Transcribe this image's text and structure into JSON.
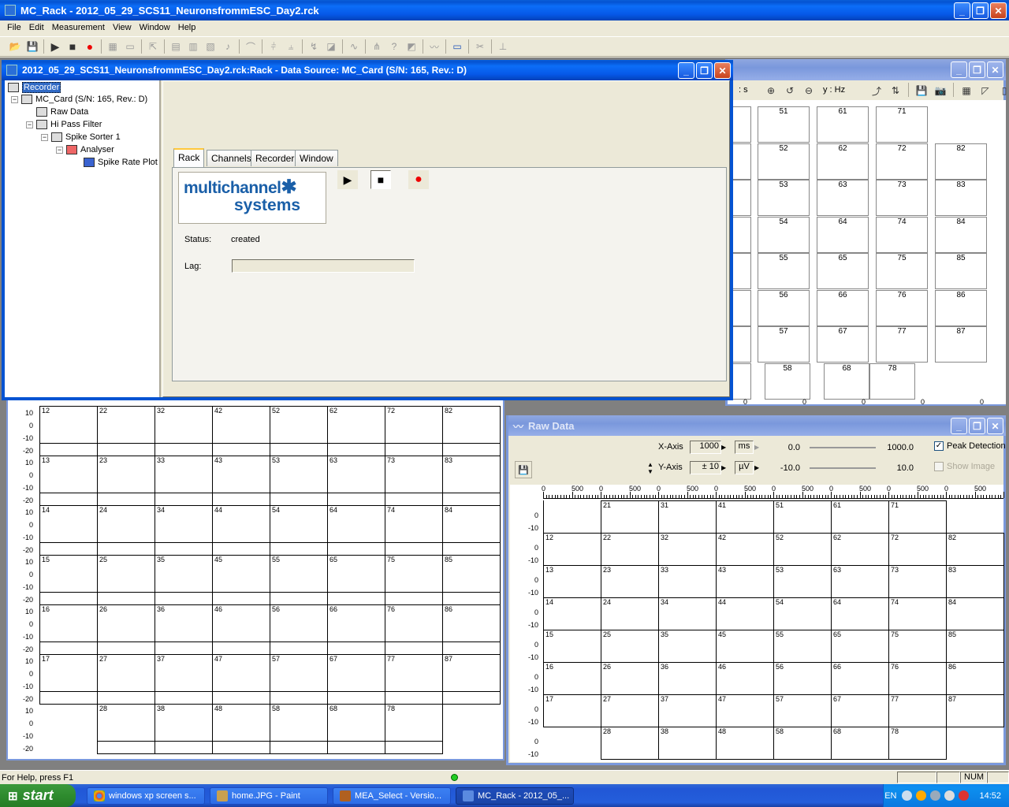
{
  "app": {
    "title": "MC_Rack - 2012_05_29_SCS11_NeuronsfrommESC_Day2.rck"
  },
  "menu": [
    "File",
    "Edit",
    "Measurement",
    "View",
    "Window",
    "Help"
  ],
  "rack": {
    "title": "2012_05_29_SCS11_NeuronsfrommESC_Day2.rck:Rack - Data Source: MC_Card (S/N: 165, Rev.: D)",
    "tree": [
      "Recorder",
      "MC_Card (S/N: 165, Rev.: D)",
      "Raw Data",
      "Hi Pass Filter",
      "Spike Sorter 1",
      "Analyser",
      "Spike Rate Plot"
    ],
    "tabs": [
      "Rack",
      "Channels",
      "Recorder",
      "Window"
    ],
    "logo_line1": "multichannel",
    "logo_line2": "systems",
    "status_label": "Status:",
    "status_value": "created",
    "lag_label": "Lag:"
  },
  "spikeplot": {
    "xlabel": ": s",
    "ylabel": "y : Hz",
    "cols": [
      [
        "51",
        "52",
        "53",
        "54",
        "55",
        "56",
        "57",
        "58"
      ],
      [
        "61",
        "62",
        "63",
        "64",
        "65",
        "66",
        "67",
        "68"
      ],
      [
        "71",
        "72",
        "73",
        "74",
        "75",
        "76",
        "77",
        "78"
      ],
      [
        "",
        "82",
        "83",
        "84",
        "85",
        "86",
        "87",
        ""
      ]
    ],
    "bottom_ticks": [
      "0",
      "0",
      "0",
      "0",
      "0",
      "0"
    ]
  },
  "bgwin": {
    "ylabels": [
      "10",
      "0",
      "-10",
      "-20"
    ],
    "rows": [
      [
        "12",
        "22",
        "32",
        "42",
        "52",
        "62",
        "72",
        "82"
      ],
      [
        "13",
        "23",
        "33",
        "43",
        "53",
        "63",
        "73",
        "83"
      ],
      [
        "14",
        "24",
        "34",
        "44",
        "54",
        "64",
        "74",
        "84"
      ],
      [
        "15",
        "25",
        "35",
        "45",
        "55",
        "65",
        "75",
        "85"
      ],
      [
        "16",
        "26",
        "36",
        "46",
        "56",
        "66",
        "76",
        "86"
      ],
      [
        "17",
        "27",
        "37",
        "47",
        "57",
        "67",
        "77",
        "87"
      ],
      [
        "",
        "28",
        "38",
        "48",
        "58",
        "68",
        "78",
        ""
      ]
    ]
  },
  "rawdata": {
    "title": "Raw Data",
    "xaxis_label": "X-Axis",
    "xaxis_value": "1000",
    "xaxis_unit": "ms",
    "yaxis_label": "Y-Axis",
    "yaxis_value": "± 10",
    "yaxis_unit": "µV",
    "x_min": "0.0",
    "x_max": "1000.0",
    "y_min": "-10.0",
    "y_max": "10.0",
    "peak_detection": "Peak Detection",
    "show_image": "Show Image",
    "ruler_labels": [
      "0",
      "500",
      "0",
      "500",
      "0",
      "500",
      "0",
      "500",
      "0",
      "500",
      "0",
      "500",
      "0",
      "500",
      "0",
      "500"
    ],
    "ylabels": [
      "0",
      "-10"
    ],
    "rows": [
      [
        "",
        "21",
        "31",
        "41",
        "51",
        "61",
        "71",
        ""
      ],
      [
        "12",
        "22",
        "32",
        "42",
        "52",
        "62",
        "72",
        "82"
      ],
      [
        "13",
        "23",
        "33",
        "43",
        "53",
        "63",
        "73",
        "83"
      ],
      [
        "14",
        "24",
        "34",
        "44",
        "54",
        "64",
        "74",
        "84"
      ],
      [
        "15",
        "25",
        "35",
        "45",
        "55",
        "65",
        "75",
        "85"
      ],
      [
        "16",
        "26",
        "36",
        "46",
        "56",
        "66",
        "76",
        "86"
      ],
      [
        "17",
        "27",
        "37",
        "47",
        "57",
        "67",
        "77",
        "87"
      ],
      [
        "",
        "28",
        "38",
        "48",
        "58",
        "68",
        "78",
        ""
      ]
    ]
  },
  "status": {
    "help": "For Help, press F1",
    "num": "NUM"
  },
  "taskbar": {
    "start": "start",
    "tasks": [
      "windows xp screen s...",
      "home.JPG - Paint",
      "MEA_Select - Versio...",
      "MC_Rack - 2012_05_..."
    ],
    "lang": "EN",
    "clock": "14:52"
  },
  "colors": {
    "xp_blue": "#0553d2",
    "face": "#ece9d8",
    "taskbar": "#245edb",
    "start_green": "#2e8b2e",
    "logo_blue": "#1a5fa8"
  }
}
